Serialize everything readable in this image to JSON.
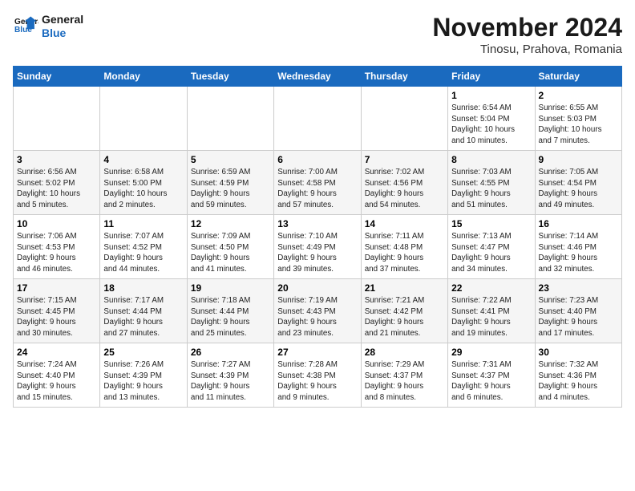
{
  "logo": {
    "line1": "General",
    "line2": "Blue"
  },
  "title": "November 2024",
  "subtitle": "Tinosu, Prahova, Romania",
  "weekdays": [
    "Sunday",
    "Monday",
    "Tuesday",
    "Wednesday",
    "Thursday",
    "Friday",
    "Saturday"
  ],
  "weeks": [
    [
      {
        "day": "",
        "info": ""
      },
      {
        "day": "",
        "info": ""
      },
      {
        "day": "",
        "info": ""
      },
      {
        "day": "",
        "info": ""
      },
      {
        "day": "",
        "info": ""
      },
      {
        "day": "1",
        "info": "Sunrise: 6:54 AM\nSunset: 5:04 PM\nDaylight: 10 hours\nand 10 minutes."
      },
      {
        "day": "2",
        "info": "Sunrise: 6:55 AM\nSunset: 5:03 PM\nDaylight: 10 hours\nand 7 minutes."
      }
    ],
    [
      {
        "day": "3",
        "info": "Sunrise: 6:56 AM\nSunset: 5:02 PM\nDaylight: 10 hours\nand 5 minutes."
      },
      {
        "day": "4",
        "info": "Sunrise: 6:58 AM\nSunset: 5:00 PM\nDaylight: 10 hours\nand 2 minutes."
      },
      {
        "day": "5",
        "info": "Sunrise: 6:59 AM\nSunset: 4:59 PM\nDaylight: 9 hours\nand 59 minutes."
      },
      {
        "day": "6",
        "info": "Sunrise: 7:00 AM\nSunset: 4:58 PM\nDaylight: 9 hours\nand 57 minutes."
      },
      {
        "day": "7",
        "info": "Sunrise: 7:02 AM\nSunset: 4:56 PM\nDaylight: 9 hours\nand 54 minutes."
      },
      {
        "day": "8",
        "info": "Sunrise: 7:03 AM\nSunset: 4:55 PM\nDaylight: 9 hours\nand 51 minutes."
      },
      {
        "day": "9",
        "info": "Sunrise: 7:05 AM\nSunset: 4:54 PM\nDaylight: 9 hours\nand 49 minutes."
      }
    ],
    [
      {
        "day": "10",
        "info": "Sunrise: 7:06 AM\nSunset: 4:53 PM\nDaylight: 9 hours\nand 46 minutes."
      },
      {
        "day": "11",
        "info": "Sunrise: 7:07 AM\nSunset: 4:52 PM\nDaylight: 9 hours\nand 44 minutes."
      },
      {
        "day": "12",
        "info": "Sunrise: 7:09 AM\nSunset: 4:50 PM\nDaylight: 9 hours\nand 41 minutes."
      },
      {
        "day": "13",
        "info": "Sunrise: 7:10 AM\nSunset: 4:49 PM\nDaylight: 9 hours\nand 39 minutes."
      },
      {
        "day": "14",
        "info": "Sunrise: 7:11 AM\nSunset: 4:48 PM\nDaylight: 9 hours\nand 37 minutes."
      },
      {
        "day": "15",
        "info": "Sunrise: 7:13 AM\nSunset: 4:47 PM\nDaylight: 9 hours\nand 34 minutes."
      },
      {
        "day": "16",
        "info": "Sunrise: 7:14 AM\nSunset: 4:46 PM\nDaylight: 9 hours\nand 32 minutes."
      }
    ],
    [
      {
        "day": "17",
        "info": "Sunrise: 7:15 AM\nSunset: 4:45 PM\nDaylight: 9 hours\nand 30 minutes."
      },
      {
        "day": "18",
        "info": "Sunrise: 7:17 AM\nSunset: 4:44 PM\nDaylight: 9 hours\nand 27 minutes."
      },
      {
        "day": "19",
        "info": "Sunrise: 7:18 AM\nSunset: 4:44 PM\nDaylight: 9 hours\nand 25 minutes."
      },
      {
        "day": "20",
        "info": "Sunrise: 7:19 AM\nSunset: 4:43 PM\nDaylight: 9 hours\nand 23 minutes."
      },
      {
        "day": "21",
        "info": "Sunrise: 7:21 AM\nSunset: 4:42 PM\nDaylight: 9 hours\nand 21 minutes."
      },
      {
        "day": "22",
        "info": "Sunrise: 7:22 AM\nSunset: 4:41 PM\nDaylight: 9 hours\nand 19 minutes."
      },
      {
        "day": "23",
        "info": "Sunrise: 7:23 AM\nSunset: 4:40 PM\nDaylight: 9 hours\nand 17 minutes."
      }
    ],
    [
      {
        "day": "24",
        "info": "Sunrise: 7:24 AM\nSunset: 4:40 PM\nDaylight: 9 hours\nand 15 minutes."
      },
      {
        "day": "25",
        "info": "Sunrise: 7:26 AM\nSunset: 4:39 PM\nDaylight: 9 hours\nand 13 minutes."
      },
      {
        "day": "26",
        "info": "Sunrise: 7:27 AM\nSunset: 4:39 PM\nDaylight: 9 hours\nand 11 minutes."
      },
      {
        "day": "27",
        "info": "Sunrise: 7:28 AM\nSunset: 4:38 PM\nDaylight: 9 hours\nand 9 minutes."
      },
      {
        "day": "28",
        "info": "Sunrise: 7:29 AM\nSunset: 4:37 PM\nDaylight: 9 hours\nand 8 minutes."
      },
      {
        "day": "29",
        "info": "Sunrise: 7:31 AM\nSunset: 4:37 PM\nDaylight: 9 hours\nand 6 minutes."
      },
      {
        "day": "30",
        "info": "Sunrise: 7:32 AM\nSunset: 4:36 PM\nDaylight: 9 hours\nand 4 minutes."
      }
    ]
  ]
}
